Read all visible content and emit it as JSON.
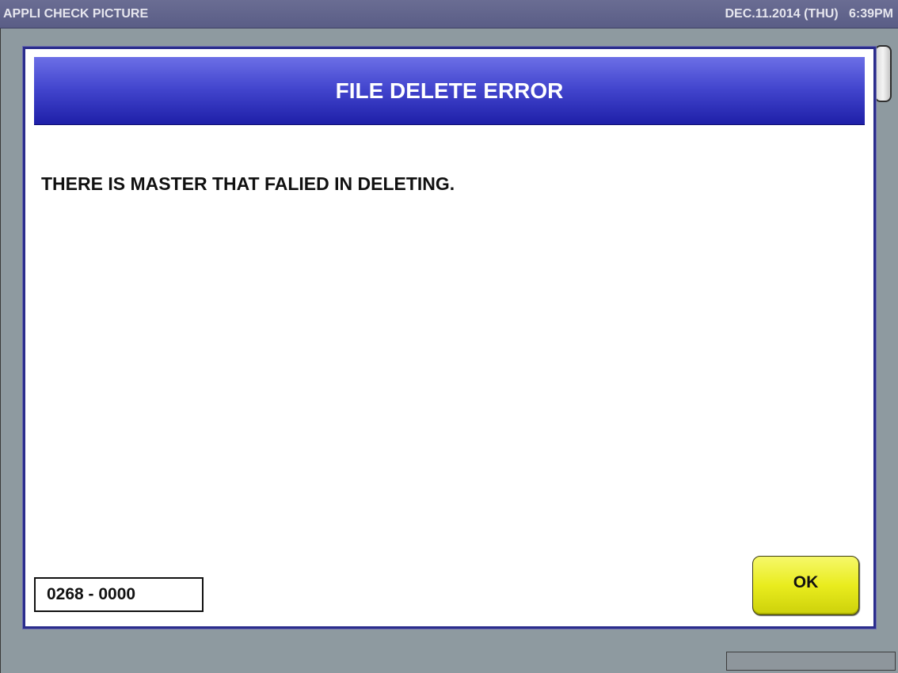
{
  "topbar": {
    "title": "APPLI CHECK PICTURE",
    "datetime": "DEC.11.2014 (THU)   6:39PM"
  },
  "dialog": {
    "title": "FILE DELETE ERROR",
    "message": "THERE IS MASTER THAT FALIED IN DELETING.",
    "error_code": "0268 - 0000",
    "ok_label": "OK"
  },
  "colors": {
    "header_blue": "#3033c4",
    "ok_yellow": "#e9ec1e",
    "background_gray": "#8e9aa0"
  }
}
